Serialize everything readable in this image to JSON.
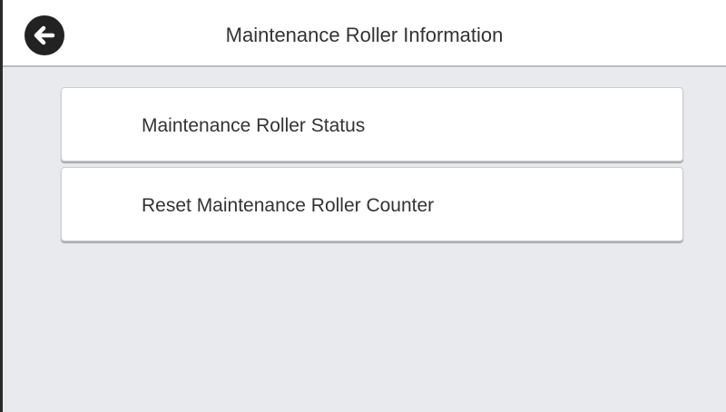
{
  "header": {
    "title": "Maintenance Roller Information",
    "back_icon": "back-arrow-icon"
  },
  "menu": {
    "items": [
      {
        "label": "Maintenance Roller Status"
      },
      {
        "label": "Reset Maintenance Roller Counter"
      }
    ]
  },
  "colors": {
    "background": "#e8eaed",
    "header_background": "#ffffff",
    "button_background": "#ffffff",
    "back_button": "#222222",
    "text": "#333333"
  }
}
